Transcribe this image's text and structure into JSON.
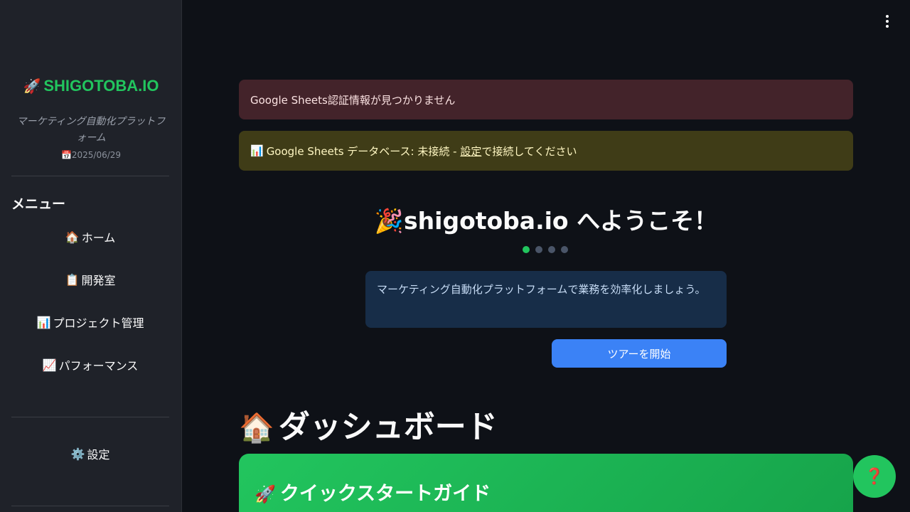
{
  "sidebar": {
    "brand_icon": "🚀",
    "brand_name": "SHIGOTOBA.IO",
    "tagline": "マーケティング自動化プラットフォーム",
    "date_icon": "📅",
    "date": "2025/06/29",
    "menu_title": "メニュー",
    "items": [
      {
        "icon": "🏠",
        "label": "ホーム"
      },
      {
        "icon": "📋",
        "label": "開発室"
      },
      {
        "icon": "📊",
        "label": "プロジェクト管理"
      },
      {
        "icon": "📈",
        "label": "パフォーマンス"
      }
    ],
    "settings": {
      "icon": "⚙️",
      "label": "設定"
    }
  },
  "alerts": {
    "error_text": "Google Sheets認証情報が見つかりません",
    "warning_icon": "📊",
    "warning_prefix": "Google Sheets データベース: 未接続 - ",
    "warning_link": "設定",
    "warning_suffix": "で接続してください"
  },
  "welcome": {
    "icon": "🎉",
    "title": "shigotoba.io へようこそ！",
    "step_total": 4,
    "step_current": 1,
    "info_text": "マーケティング自動化プラットフォームで業務を効率化しましょう。",
    "tour_button": "ツアーを開始"
  },
  "dashboard": {
    "icon": "🏠",
    "title": "ダッシュボード",
    "quick_icon": "🚀",
    "quick_title": "クイックスタートガイド"
  },
  "help_button": "❓",
  "colors": {
    "accent": "#22c55e",
    "primary_button": "#3b82f6",
    "error_bg": "#43232a",
    "warning_bg": "#3f3c17",
    "info_bg": "#172d48"
  }
}
